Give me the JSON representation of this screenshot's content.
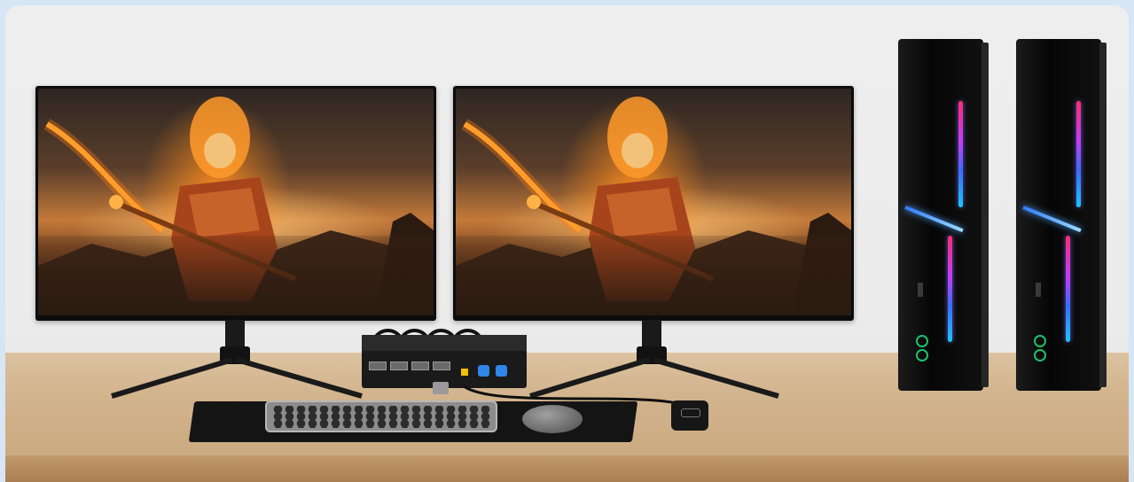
{
  "scene": {
    "objects": [
      "left-monitor",
      "right-monitor",
      "kvm-switch",
      "keyboard",
      "mouse",
      "mouse-pad",
      "remote",
      "left-pc-tower",
      "right-pc-tower"
    ]
  },
  "colors": {
    "background": "#d7e6f5",
    "wall": "#ececec",
    "desk": "#d1b38c",
    "accent_blue": "#2f86e6",
    "rgb_light": "#3a6bff"
  },
  "icons": [
    "monitor-icon",
    "keyboard-icon",
    "mouse-icon",
    "pc-tower-icon"
  ]
}
